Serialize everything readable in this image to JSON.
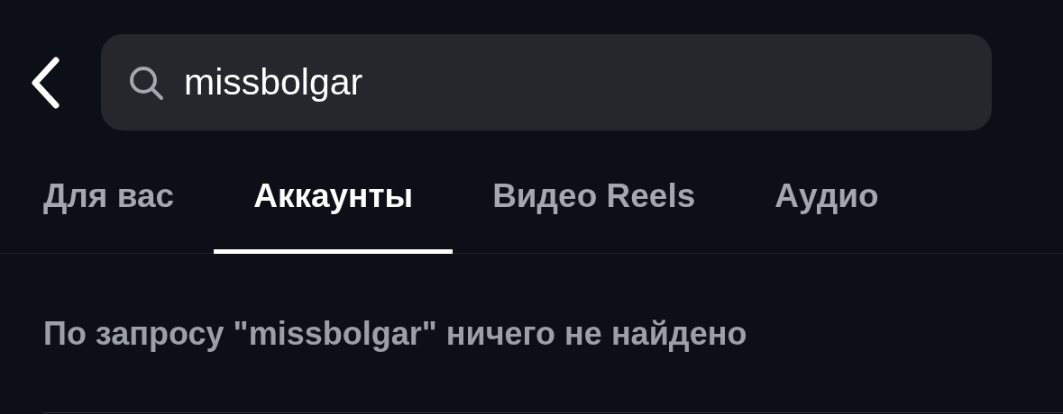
{
  "search": {
    "value": "missbolgar"
  },
  "tabs": [
    {
      "label": "Для вас",
      "selected": false
    },
    {
      "label": "Аккаунты",
      "selected": true
    },
    {
      "label": "Видео Reels",
      "selected": false
    },
    {
      "label": "Аудио",
      "selected": false
    }
  ],
  "message": "По запросу \"missbolgar\" ничего не найдено"
}
